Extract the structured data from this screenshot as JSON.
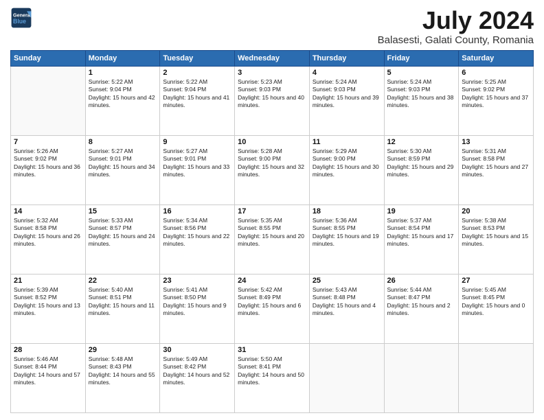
{
  "logo": {
    "line1": "General",
    "line2": "Blue"
  },
  "title": "July 2024",
  "subtitle": "Balasesti, Galati County, Romania",
  "weekdays": [
    "Sunday",
    "Monday",
    "Tuesday",
    "Wednesday",
    "Thursday",
    "Friday",
    "Saturday"
  ],
  "weeks": [
    [
      null,
      {
        "day": 1,
        "sunrise": "5:22 AM",
        "sunset": "9:04 PM",
        "daylight": "15 hours and 42 minutes."
      },
      {
        "day": 2,
        "sunrise": "5:22 AM",
        "sunset": "9:04 PM",
        "daylight": "15 hours and 41 minutes."
      },
      {
        "day": 3,
        "sunrise": "5:23 AM",
        "sunset": "9:03 PM",
        "daylight": "15 hours and 40 minutes."
      },
      {
        "day": 4,
        "sunrise": "5:24 AM",
        "sunset": "9:03 PM",
        "daylight": "15 hours and 39 minutes."
      },
      {
        "day": 5,
        "sunrise": "5:24 AM",
        "sunset": "9:03 PM",
        "daylight": "15 hours and 38 minutes."
      },
      {
        "day": 6,
        "sunrise": "5:25 AM",
        "sunset": "9:02 PM",
        "daylight": "15 hours and 37 minutes."
      }
    ],
    [
      {
        "day": 7,
        "sunrise": "5:26 AM",
        "sunset": "9:02 PM",
        "daylight": "15 hours and 36 minutes."
      },
      {
        "day": 8,
        "sunrise": "5:27 AM",
        "sunset": "9:01 PM",
        "daylight": "15 hours and 34 minutes."
      },
      {
        "day": 9,
        "sunrise": "5:27 AM",
        "sunset": "9:01 PM",
        "daylight": "15 hours and 33 minutes."
      },
      {
        "day": 10,
        "sunrise": "5:28 AM",
        "sunset": "9:00 PM",
        "daylight": "15 hours and 32 minutes."
      },
      {
        "day": 11,
        "sunrise": "5:29 AM",
        "sunset": "9:00 PM",
        "daylight": "15 hours and 30 minutes."
      },
      {
        "day": 12,
        "sunrise": "5:30 AM",
        "sunset": "8:59 PM",
        "daylight": "15 hours and 29 minutes."
      },
      {
        "day": 13,
        "sunrise": "5:31 AM",
        "sunset": "8:58 PM",
        "daylight": "15 hours and 27 minutes."
      }
    ],
    [
      {
        "day": 14,
        "sunrise": "5:32 AM",
        "sunset": "8:58 PM",
        "daylight": "15 hours and 26 minutes."
      },
      {
        "day": 15,
        "sunrise": "5:33 AM",
        "sunset": "8:57 PM",
        "daylight": "15 hours and 24 minutes."
      },
      {
        "day": 16,
        "sunrise": "5:34 AM",
        "sunset": "8:56 PM",
        "daylight": "15 hours and 22 minutes."
      },
      {
        "day": 17,
        "sunrise": "5:35 AM",
        "sunset": "8:55 PM",
        "daylight": "15 hours and 20 minutes."
      },
      {
        "day": 18,
        "sunrise": "5:36 AM",
        "sunset": "8:55 PM",
        "daylight": "15 hours and 19 minutes."
      },
      {
        "day": 19,
        "sunrise": "5:37 AM",
        "sunset": "8:54 PM",
        "daylight": "15 hours and 17 minutes."
      },
      {
        "day": 20,
        "sunrise": "5:38 AM",
        "sunset": "8:53 PM",
        "daylight": "15 hours and 15 minutes."
      }
    ],
    [
      {
        "day": 21,
        "sunrise": "5:39 AM",
        "sunset": "8:52 PM",
        "daylight": "15 hours and 13 minutes."
      },
      {
        "day": 22,
        "sunrise": "5:40 AM",
        "sunset": "8:51 PM",
        "daylight": "15 hours and 11 minutes."
      },
      {
        "day": 23,
        "sunrise": "5:41 AM",
        "sunset": "8:50 PM",
        "daylight": "15 hours and 9 minutes."
      },
      {
        "day": 24,
        "sunrise": "5:42 AM",
        "sunset": "8:49 PM",
        "daylight": "15 hours and 6 minutes."
      },
      {
        "day": 25,
        "sunrise": "5:43 AM",
        "sunset": "8:48 PM",
        "daylight": "15 hours and 4 minutes."
      },
      {
        "day": 26,
        "sunrise": "5:44 AM",
        "sunset": "8:47 PM",
        "daylight": "15 hours and 2 minutes."
      },
      {
        "day": 27,
        "sunrise": "5:45 AM",
        "sunset": "8:45 PM",
        "daylight": "15 hours and 0 minutes."
      }
    ],
    [
      {
        "day": 28,
        "sunrise": "5:46 AM",
        "sunset": "8:44 PM",
        "daylight": "14 hours and 57 minutes."
      },
      {
        "day": 29,
        "sunrise": "5:48 AM",
        "sunset": "8:43 PM",
        "daylight": "14 hours and 55 minutes."
      },
      {
        "day": 30,
        "sunrise": "5:49 AM",
        "sunset": "8:42 PM",
        "daylight": "14 hours and 52 minutes."
      },
      {
        "day": 31,
        "sunrise": "5:50 AM",
        "sunset": "8:41 PM",
        "daylight": "14 hours and 50 minutes."
      },
      null,
      null,
      null
    ]
  ]
}
